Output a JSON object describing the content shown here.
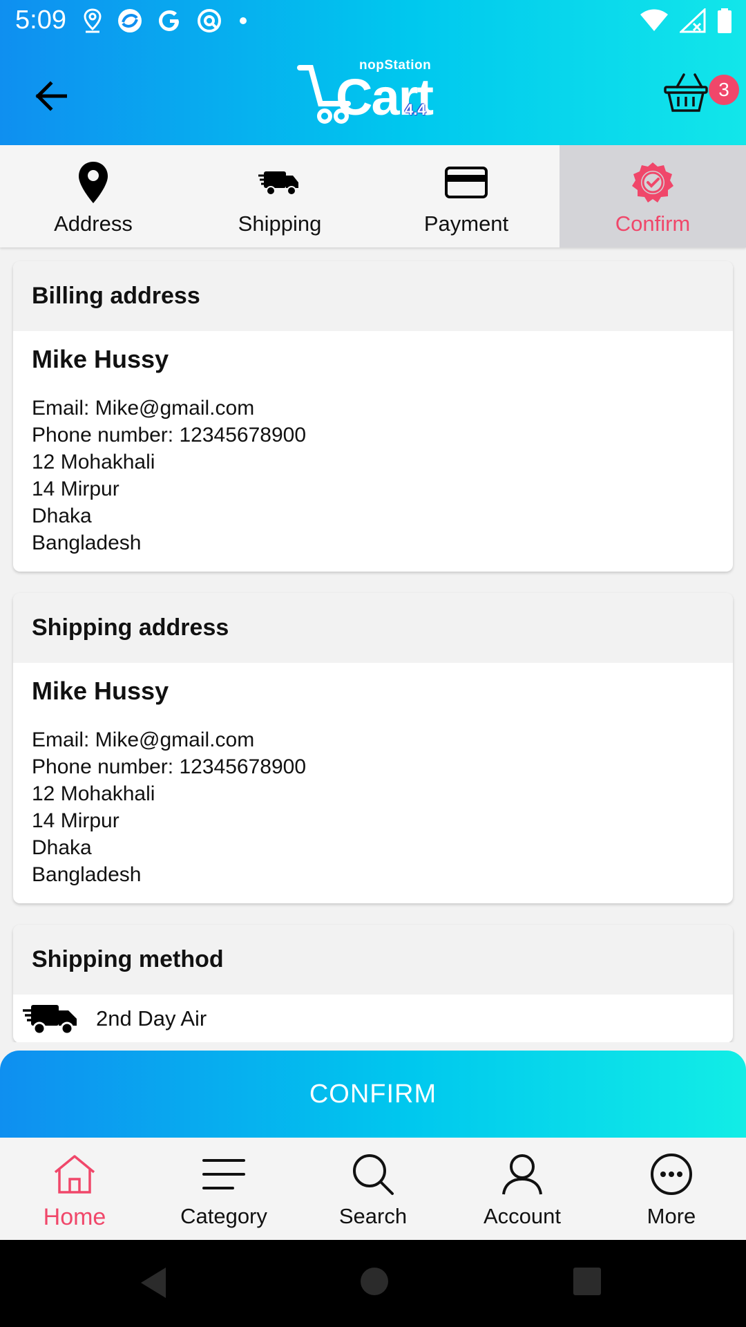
{
  "status_bar": {
    "time": "5:09"
  },
  "header": {
    "logo_small": "nopStation",
    "logo_big": "Cart",
    "logo_version": "4.4",
    "cart_count": "3"
  },
  "steps": [
    {
      "label": "Address",
      "icon": "location-pin-icon"
    },
    {
      "label": "Shipping",
      "icon": "truck-icon"
    },
    {
      "label": "Payment",
      "icon": "credit-card-icon"
    },
    {
      "label": "Confirm",
      "icon": "verified-badge-icon",
      "active": true
    }
  ],
  "billing": {
    "title": "Billing address",
    "name": "Mike Hussy",
    "email": "Email: Mike@gmail.com",
    "phone": "Phone number: 12345678900",
    "address1": "12 Mohakhali",
    "address2": "14 Mirpur",
    "city": "Dhaka",
    "country": "Bangladesh"
  },
  "shipping": {
    "title": "Shipping address",
    "name": "Mike Hussy",
    "email": "Email: Mike@gmail.com",
    "phone": "Phone number: 12345678900",
    "address1": "12 Mohakhali",
    "address2": "14 Mirpur",
    "city": "Dhaka",
    "country": "Bangladesh"
  },
  "shipping_method": {
    "title": "Shipping method",
    "method": "2nd Day Air"
  },
  "confirm_button": "CONFIRM",
  "bottom_nav": [
    {
      "label": "Home",
      "icon": "home-icon",
      "active": true
    },
    {
      "label": "Category",
      "icon": "menu-icon"
    },
    {
      "label": "Search",
      "icon": "search-icon"
    },
    {
      "label": "Account",
      "icon": "account-icon"
    },
    {
      "label": "More",
      "icon": "more-icon"
    }
  ],
  "colors": {
    "accent": "#f0476a",
    "gradient_start": "#0f8ff0",
    "gradient_end": "#12e6ea"
  }
}
